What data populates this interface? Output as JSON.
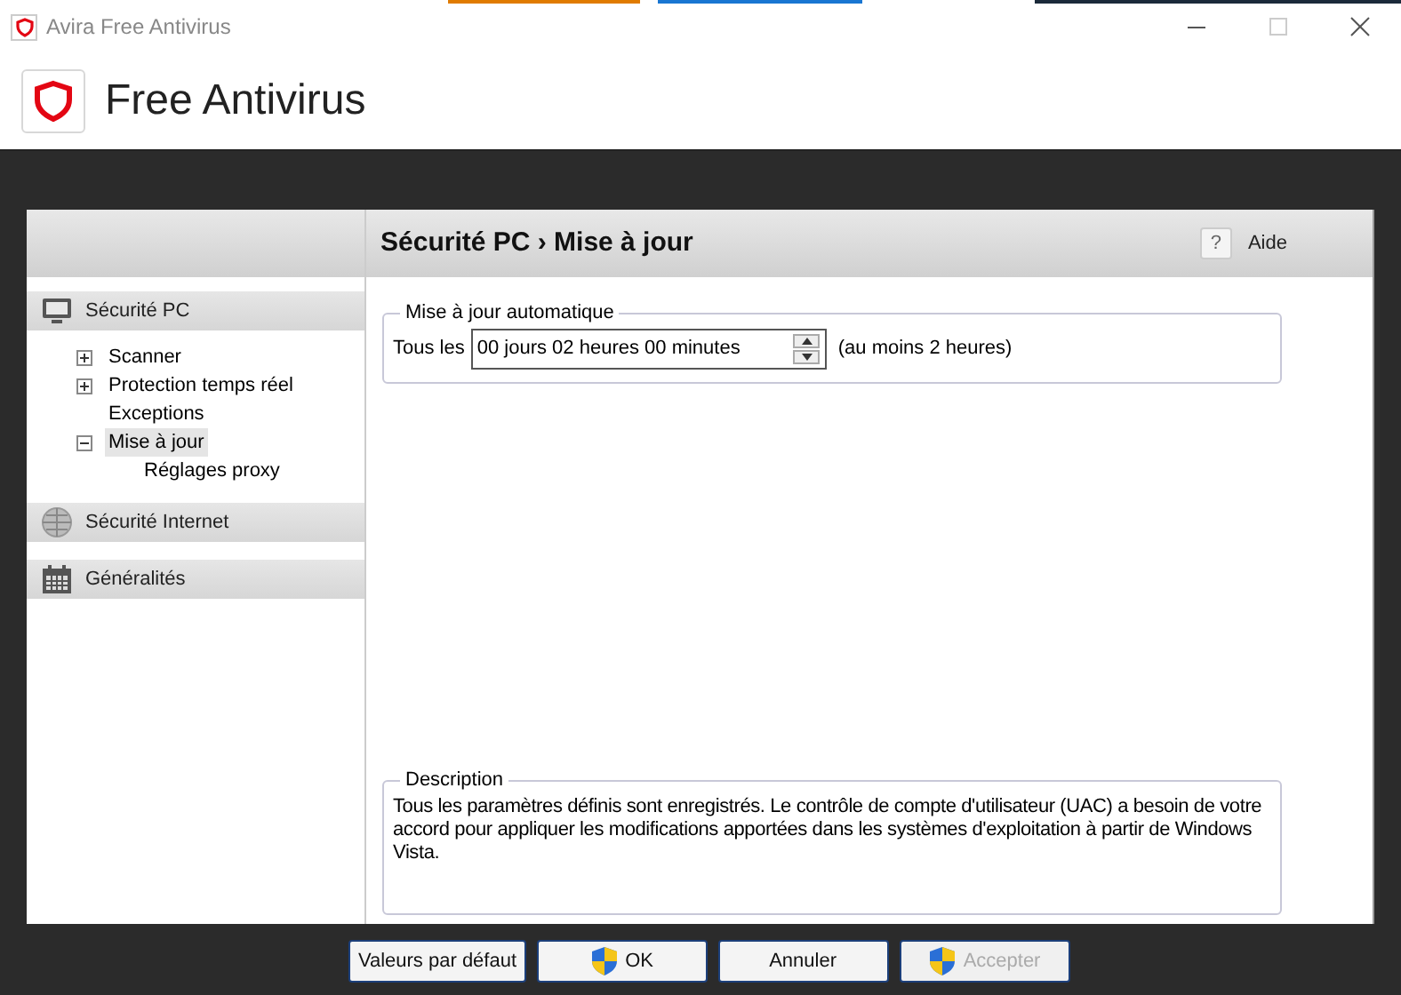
{
  "window": {
    "title": "Avira Free Antivirus"
  },
  "app_header": {
    "title": "Free Antivirus"
  },
  "sidebar": {
    "sections": [
      {
        "label": "Sécurité PC",
        "kind": "monitor",
        "items": [
          {
            "label": "Scanner",
            "expanded": false,
            "selected": false
          },
          {
            "label": "Protection temps réel",
            "expanded": false,
            "selected": false
          },
          {
            "label": "Exceptions",
            "selected": false
          },
          {
            "label": "Mise à jour",
            "expanded": true,
            "selected": true,
            "children": [
              {
                "label": "Réglages proxy",
                "selected": false
              }
            ]
          }
        ]
      },
      {
        "label": "Sécurité Internet",
        "kind": "globe"
      },
      {
        "label": "Généralités",
        "kind": "calendar"
      }
    ]
  },
  "content": {
    "breadcrumb": "Sécurité PC › Mise à jour",
    "help_icon": "?",
    "help_label": "Aide",
    "auto_update": {
      "legend": "Mise à jour automatique",
      "label": "Tous les",
      "value": "00 jours 02 heures 00 minutes",
      "hint": "(au moins 2 heures)"
    },
    "description": {
      "legend": "Description",
      "text": "Tous les paramètres définis sont enregistrés. Le contrôle de compte d'utilisateur (UAC) a besoin de votre accord pour appliquer les modifications apportées dans les systèmes d'exploitation à partir de Windows Vista."
    }
  },
  "buttons": [
    {
      "label": "Valeurs par défaut",
      "shield": false,
      "disabled": false
    },
    {
      "label": "OK",
      "shield": true,
      "disabled": false
    },
    {
      "label": "Annuler",
      "shield": false,
      "disabled": false
    },
    {
      "label": "Accepter",
      "shield": true,
      "disabled": true
    }
  ]
}
